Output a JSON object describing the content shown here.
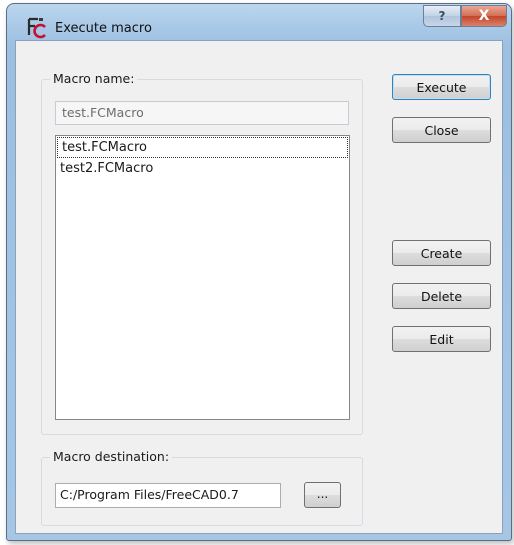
{
  "window": {
    "title": "Execute macro",
    "help_label": "?",
    "close_label": "X"
  },
  "macro_name": {
    "group_label": "Macro name:",
    "input_value": "test.FCMacro",
    "list_items": [
      "test.FCMacro",
      "test2.FCMacro"
    ],
    "selected_index": 0
  },
  "macro_destination": {
    "group_label": "Macro destination:",
    "path_value": "C:/Program Files/FreeCAD0.7",
    "browse_label": "..."
  },
  "buttons": {
    "execute": "Execute",
    "close": "Close",
    "create": "Create",
    "delete": "Delete",
    "edit": "Edit"
  },
  "colors": {
    "app_icon_red": "#c8102e",
    "title_bar": "#a9c9e7",
    "close_button": "#c4452a",
    "dialog_background": "#f0f0f0"
  },
  "icons": {
    "app": "freecad-app-icon",
    "help": "help-icon",
    "close": "close-icon"
  }
}
